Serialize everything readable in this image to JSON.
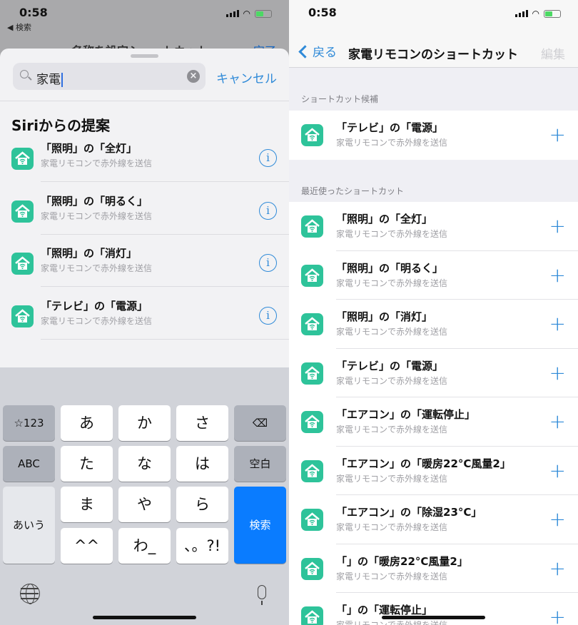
{
  "left": {
    "status": {
      "time": "0:58",
      "back_app": "◀ 検索"
    },
    "behind": {
      "title": "名称を設定ショートカット",
      "done": "完了"
    },
    "search": {
      "value": "家電",
      "clear_icon": "×",
      "cancel": "キャンセル"
    },
    "siri_title": "Siriからの提案",
    "suggestions": [
      {
        "title": "「照明」の「全灯」",
        "subtitle": "家電リモコンで赤外線を送信"
      },
      {
        "title": "「照明」の「明るく」",
        "subtitle": "家電リモコンで赤外線を送信"
      },
      {
        "title": "「照明」の「消灯」",
        "subtitle": "家電リモコンで赤外線を送信"
      },
      {
        "title": "「テレビ」の「電源」",
        "subtitle": "家電リモコンで赤外線を送信"
      }
    ],
    "info_glyph": "i",
    "keyboard": {
      "k123": "☆123",
      "a": "あ",
      "ka": "か",
      "sa": "さ",
      "del": "⌫",
      "abc": "ABC",
      "ta": "た",
      "na": "な",
      "ha": "は",
      "space": "空白",
      "aiu": "あいう",
      "ma": "ま",
      "ya": "や",
      "ra": "ら",
      "search": "検索",
      "kao": "^^",
      "wa": "わ_",
      "punct": "、。?!"
    }
  },
  "right": {
    "status": {
      "time": "0:58"
    },
    "nav": {
      "back": "戻る",
      "title": "家電リモコンのショートカット",
      "edit": "編集"
    },
    "candidates_header": "ショートカット候補",
    "candidates": [
      {
        "title": "「テレビ」の「電源」",
        "subtitle": "家電リモコンで赤外線を送信"
      }
    ],
    "recent_header": "最近使ったショートカット",
    "recent": [
      {
        "title": "「照明」の「全灯」",
        "subtitle": "家電リモコンで赤外線を送信"
      },
      {
        "title": "「照明」の「明るく」",
        "subtitle": "家電リモコンで赤外線を送信"
      },
      {
        "title": "「照明」の「消灯」",
        "subtitle": "家電リモコンで赤外線を送信"
      },
      {
        "title": "「テレビ」の「電源」",
        "subtitle": "家電リモコンで赤外線を送信"
      },
      {
        "title": "「エアコン」の「運転停止」",
        "subtitle": "家電リモコンで赤外線を送信"
      },
      {
        "title": "「エアコン」の「暖房22°C風量2」",
        "subtitle": "家電リモコンで赤外線を送信"
      },
      {
        "title": "「エアコン」の「除湿23°C」",
        "subtitle": "家電リモコンで赤外線を送信"
      },
      {
        "title": "「」の「暖房22°C風量2」",
        "subtitle": "家電リモコンで赤外線を送信"
      },
      {
        "title": "「」の「運転停止」",
        "subtitle": "家電リモコンで赤外線を送信"
      }
    ],
    "plus_glyph": "+"
  },
  "colors": {
    "accent": "#2f8ad8",
    "app_icon": "#2ec39a",
    "search_key": "#0a7cff"
  }
}
